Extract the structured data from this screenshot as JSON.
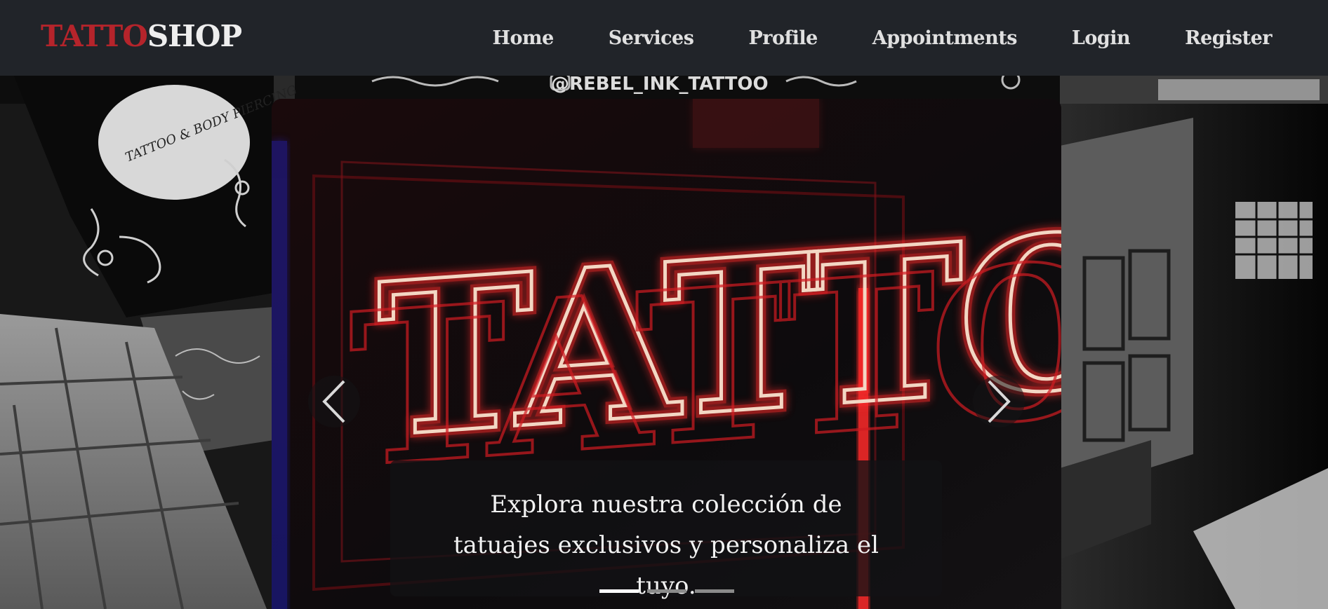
{
  "brand": {
    "part1": "TATTO",
    "part2": "SHOP"
  },
  "nav": {
    "items": [
      {
        "label": "Home"
      },
      {
        "label": "Services"
      },
      {
        "label": "Profile"
      },
      {
        "label": "Appointments"
      },
      {
        "label": "Login"
      },
      {
        "label": "Register"
      }
    ]
  },
  "background_sign": {
    "handle": "@REBEL_INK_TATTOO",
    "shop_sign": "TATTOO & BODY PIERCING"
  },
  "carousel": {
    "neon_text": "TATTOO",
    "caption": "Explora nuestra colección de tatuajes exclusivos y personaliza el tuyo.",
    "slide_count": 3,
    "active_slide": 1,
    "prev_icon": "chevron-left-icon",
    "next_icon": "chevron-right-icon"
  },
  "colors": {
    "navbar_bg": "#212429",
    "brand_red": "#b5242b",
    "neon_red": "#ff2a2a",
    "neon_core": "#f3d7c4"
  }
}
